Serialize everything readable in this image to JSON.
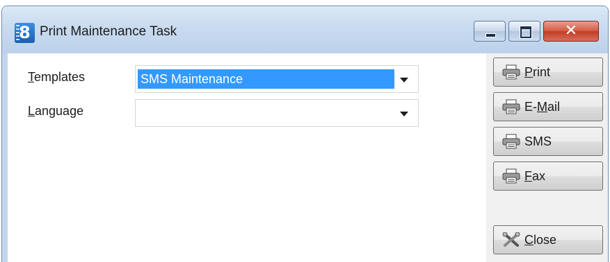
{
  "window": {
    "title": "Print Maintenance Task",
    "app_icon_glyph": "8",
    "controls": [
      "minimize-icon",
      "maximize-icon",
      "close-icon"
    ],
    "close_glyph": "✕"
  },
  "form": {
    "templates": {
      "label_mnemonic": "T",
      "label_rest": "emplates",
      "value": "SMS Maintenance"
    },
    "language": {
      "label_mnemonic": "L",
      "label_rest": "anguage",
      "value": ""
    }
  },
  "actions": {
    "print": {
      "pre": "",
      "mnemonic": "P",
      "post": "rint",
      "icon": "printer-icon"
    },
    "email": {
      "pre": "E-",
      "mnemonic": "M",
      "post": "ail",
      "icon": "printer-icon"
    },
    "sms": {
      "pre": "SMS",
      "mnemonic": "",
      "post": "",
      "icon": "printer-icon"
    },
    "fax": {
      "pre": "",
      "mnemonic": "F",
      "post": "ax",
      "icon": "printer-icon"
    },
    "close": {
      "pre": "",
      "mnemonic": "C",
      "post": "lose",
      "icon": "tools-icon"
    }
  },
  "colors": {
    "selection": "#3399ff",
    "window_frame": "#c4d6ec",
    "close_button": "#c23c22"
  }
}
